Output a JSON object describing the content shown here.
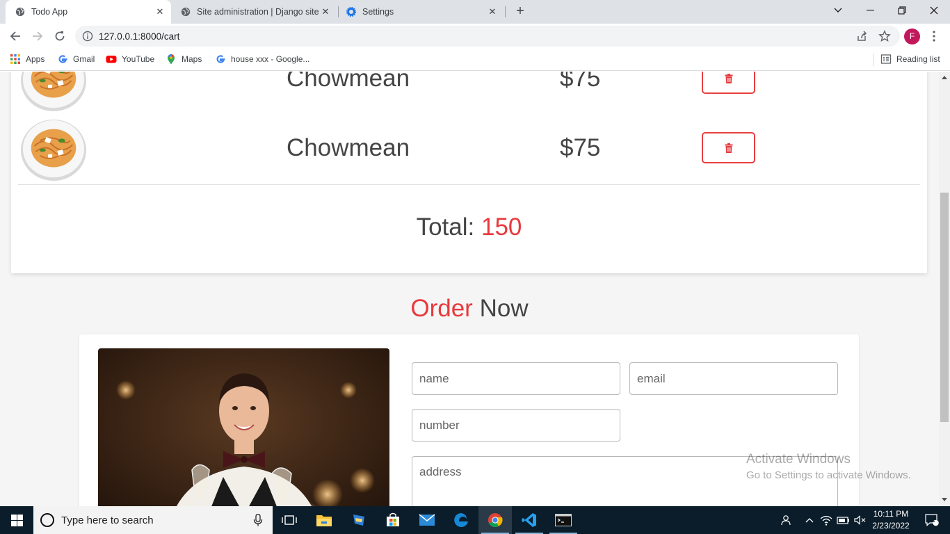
{
  "browser": {
    "tabs": [
      {
        "title": "Todo App",
        "active": true
      },
      {
        "title": "Site administration | Django site admin",
        "active": false
      },
      {
        "title": "Settings",
        "active": false
      }
    ],
    "url": "127.0.0.1:8000/cart",
    "profile_initial": "F",
    "bookmarks": [
      {
        "label": "Apps",
        "icon": "apps-grid-icon"
      },
      {
        "label": "Gmail",
        "icon": "google-icon"
      },
      {
        "label": "YouTube",
        "icon": "youtube-icon"
      },
      {
        "label": "Maps",
        "icon": "maps-pin-icon"
      },
      {
        "label": "house xxx - Google...",
        "icon": "google-icon"
      }
    ],
    "reading_list": "Reading list"
  },
  "cart": {
    "items": [
      {
        "name": "Chowmean",
        "price": "$75"
      },
      {
        "name": "Chowmean",
        "price": "$75"
      }
    ],
    "total_label": "Total:",
    "total_value": "150"
  },
  "order": {
    "heading_accent": "Order",
    "heading_rest": "Now",
    "fields": {
      "name": {
        "placeholder": "name",
        "value": ""
      },
      "email": {
        "placeholder": "email",
        "value": ""
      },
      "number": {
        "placeholder": "number",
        "value": ""
      },
      "address": {
        "placeholder": "address",
        "value": ""
      }
    }
  },
  "watermark": {
    "line1": "Activate Windows",
    "line2": "Go to Settings to activate Windows."
  },
  "taskbar": {
    "search_placeholder": "Type here to search",
    "pinned": [
      "task-view-icon",
      "file-explorer-icon",
      "app-icon",
      "store-icon",
      "mail-icon",
      "edge-icon",
      "chrome-icon",
      "vscode-icon",
      "terminal-icon"
    ],
    "time": "10:11 PM",
    "date": "2/23/2022",
    "notification_count": "2"
  },
  "colors": {
    "accent_red": "#e8393d",
    "text_gray": "#444444",
    "page_bg": "#f5f5f5",
    "taskbar_bg": "#0b1d2a"
  }
}
